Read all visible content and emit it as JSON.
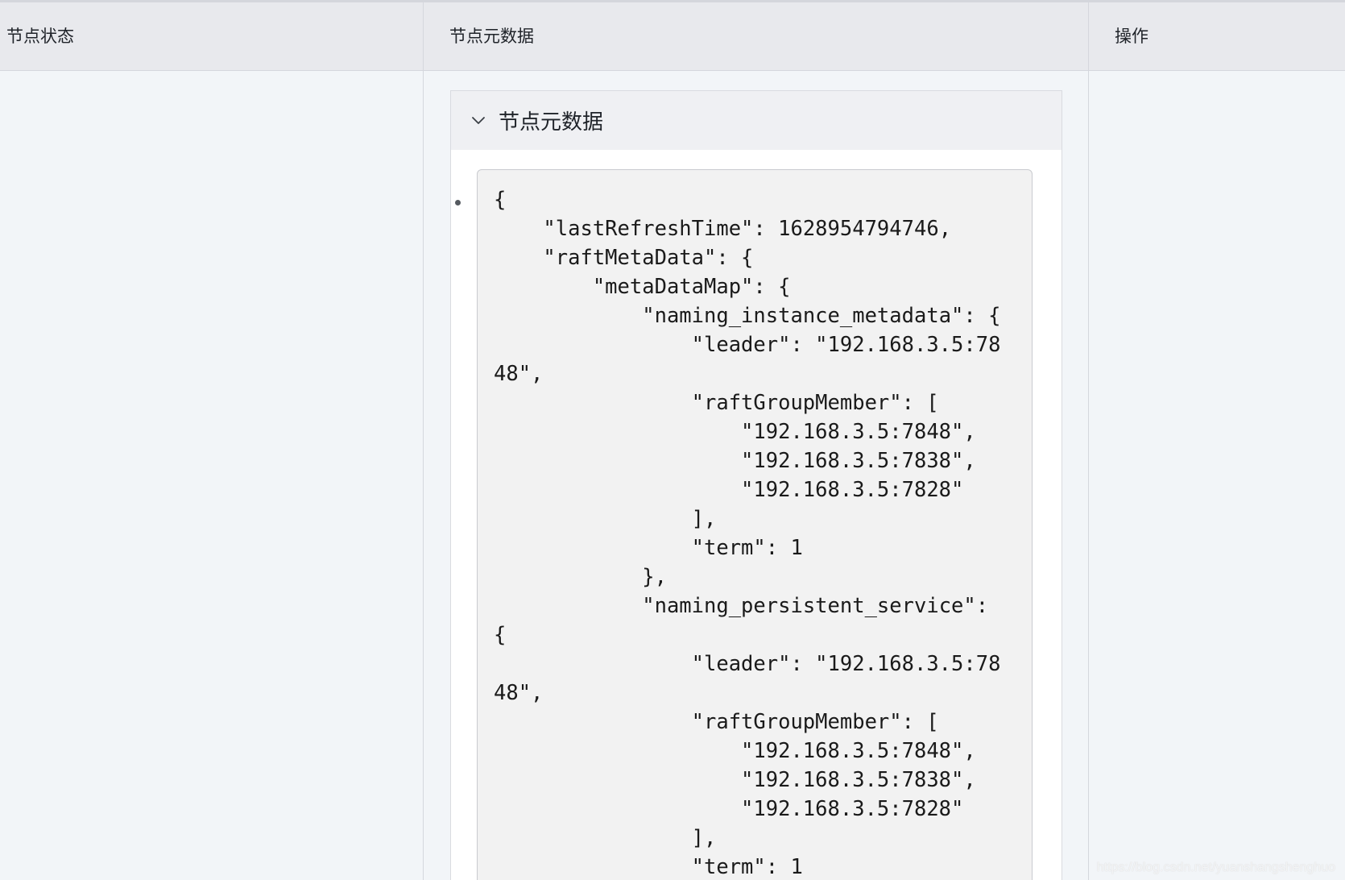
{
  "table": {
    "columns": [
      {
        "label": "节点状态"
      },
      {
        "label": "节点元数据"
      },
      {
        "label": "操作"
      }
    ]
  },
  "metadata_panel": {
    "title": "节点元数据",
    "icon": "chevron-down-icon",
    "content": "{\n    \"lastRefreshTime\": 1628954794746,\n    \"raftMetaData\": {\n        \"metaDataMap\": {\n            \"naming_instance_metadata\": {\n                \"leader\": \"192.168.3.5:7848\",\n                \"raftGroupMember\": [\n                    \"192.168.3.5:7848\",\n                    \"192.168.3.5:7838\",\n                    \"192.168.3.5:7828\"\n                ],\n                \"term\": 1\n            },\n            \"naming_persistent_service\": {\n                \"leader\": \"192.168.3.5:7848\",\n                \"raftGroupMember\": [\n                    \"192.168.3.5:7848\",\n                    \"192.168.3.5:7838\",\n                    \"192.168.3.5:7828\"\n                ],\n                \"term\": 1"
  },
  "watermark": "https://blog.csdn.net/yuanshangshenghuo"
}
